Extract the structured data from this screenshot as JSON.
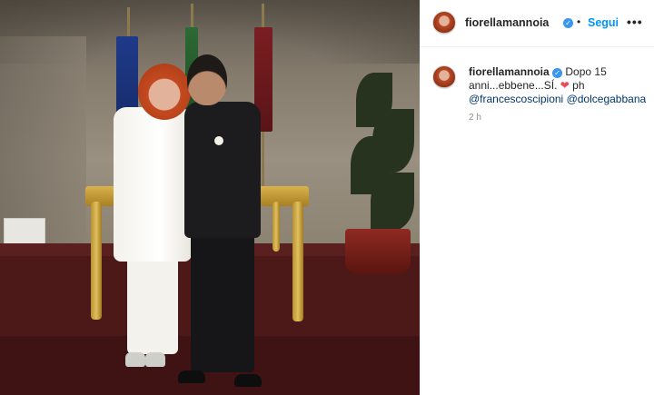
{
  "post": {
    "photo_description": "",
    "author": {
      "username": "fiorellamannoia",
      "verified": true
    },
    "header": {
      "separator": "•",
      "follow_label": "Segui",
      "more_label": "•••"
    },
    "caption": {
      "username": "fiorellamannoia",
      "text_1": "Dopo 15",
      "text_2": "anni...ebbene...SÍ.",
      "heart": "❤",
      "text_3": "ph",
      "mention_1": "@francescoscipioni",
      "mention_2": "@dolcegabbana"
    },
    "timestamp": "2 h"
  },
  "colors": {
    "link_blue": "#0095f6",
    "verified_blue": "#3897f0",
    "heart_red": "#ed4956",
    "mention_blue": "#00376b"
  },
  "icons": {
    "verified": "verified-badge-icon",
    "heart": "heart-icon",
    "more": "more-options-icon"
  }
}
